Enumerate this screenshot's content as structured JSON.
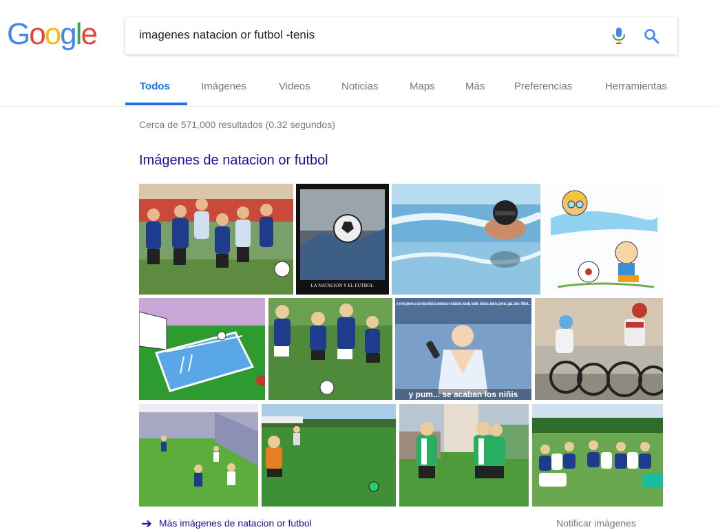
{
  "logo": {
    "letters": [
      "G",
      "o",
      "o",
      "g",
      "l",
      "e"
    ],
    "colors": [
      "#4285F4",
      "#EA4335",
      "#FBBC05",
      "#4285F4",
      "#34A853",
      "#EA4335"
    ]
  },
  "search": {
    "query": "imagenes natacion or futbol -tenis"
  },
  "tabs": [
    {
      "label": "Todos",
      "active": true
    },
    {
      "label": "Imágenes"
    },
    {
      "label": "Videos"
    },
    {
      "label": "Noticias"
    },
    {
      "label": "Maps"
    },
    {
      "label": "Más"
    },
    {
      "label": "Preferencias"
    },
    {
      "label": "Herramientas"
    }
  ],
  "results": {
    "stats": "Cerca de 571,000 resultados (0.32 segundos)"
  },
  "images": {
    "title": "Imágenes de natacion or futbol",
    "thumb2_caption": "LA NATACION Y EL FUTBOL",
    "thumb7_caption_top": "y si me ponen a sus hijos toda la semana en natación, karate, ballet, música, teatro, porras, jazz, tiaro, futbol...",
    "thumb7_caption_bottom": "y pum... se acaban los niñis",
    "more_link": "Más imágenes de natacion or futbol",
    "report": "Notificar imágenes"
  },
  "colors": {
    "accent": "#1a73e8",
    "link": "#1a0dab",
    "muted": "#777777"
  }
}
